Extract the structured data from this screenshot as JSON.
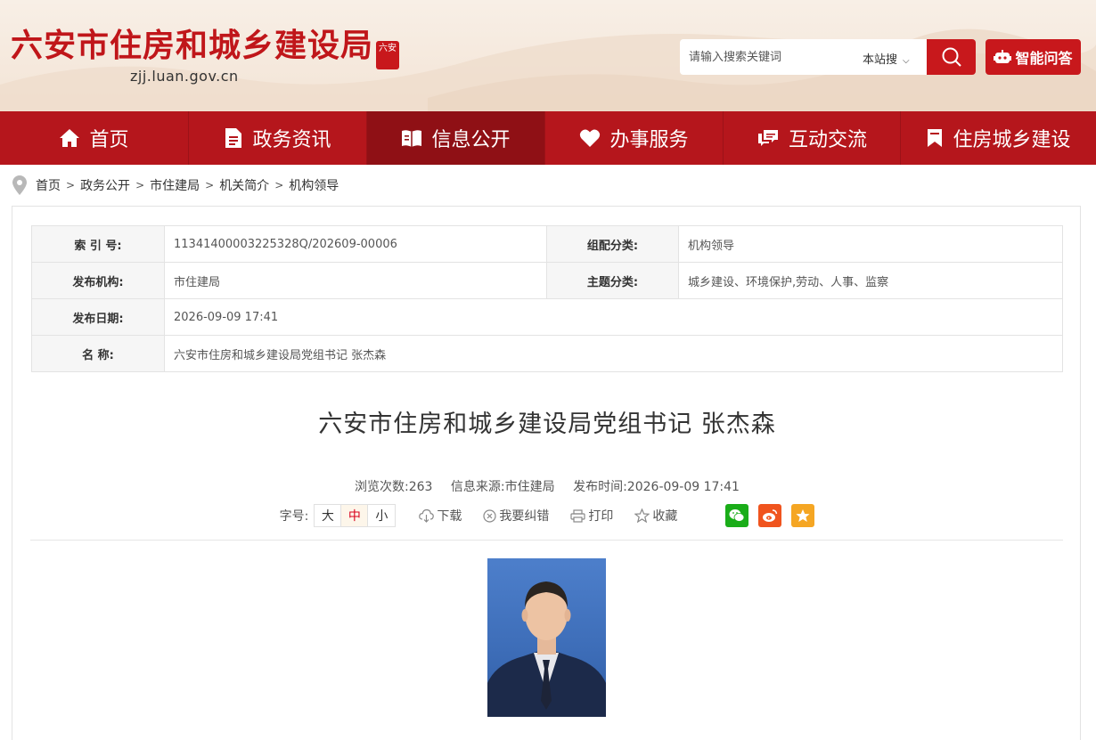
{
  "header": {
    "site_title": "六安市住房和城乡建设局",
    "site_domain": "zjj.luan.gov.cn",
    "seal_text": "六安",
    "search": {
      "placeholder": "请输入搜索关键词",
      "scope": "本站搜",
      "ai_label": "智能问答"
    }
  },
  "nav": {
    "items": [
      {
        "label": "首页",
        "icon": "home-icon"
      },
      {
        "label": "政务资讯",
        "icon": "document-icon"
      },
      {
        "label": "信息公开",
        "icon": "open-book-icon"
      },
      {
        "label": "办事服务",
        "icon": "heart-icon"
      },
      {
        "label": "互动交流",
        "icon": "chat-icon"
      },
      {
        "label": "住房城乡建设",
        "icon": "bookmark-icon"
      }
    ],
    "active": "信息公开"
  },
  "breadcrumb": [
    "首页",
    "政务公开",
    "市住建局",
    "机关简介",
    "机构领导"
  ],
  "meta": {
    "index_label": "索 引 号:",
    "index_value": "11341400003225328Q/202609-00006",
    "group_label": "组配分类:",
    "group_value": "机构领导",
    "publisher_label": "发布机构:",
    "publisher_value": "市住建局",
    "topic_label": "主题分类:",
    "topic_value": "城乡建设、环境保护,劳动、人事、监察",
    "date_label": "发布日期:",
    "date_value": "2026-09-09 17:41",
    "name_label": "名 称:",
    "name_value": "六安市住房和城乡建设局党组书记 张杰森"
  },
  "article": {
    "title": "六安市住房和城乡建设局党组书记 张杰森",
    "views": "浏览次数:263",
    "source": "信息来源:市住建局",
    "published": "发布时间:2026-09-09 17:41"
  },
  "tools": {
    "fontsize_label": "字号:",
    "sizes": [
      "大",
      "中",
      "小"
    ],
    "download": "下载",
    "correct": "我要纠错",
    "print": "打印",
    "favorite": "收藏"
  },
  "colors": {
    "brand_red": "#c8181c",
    "nav_red": "#b5161c",
    "nav_active": "#8f1015"
  }
}
